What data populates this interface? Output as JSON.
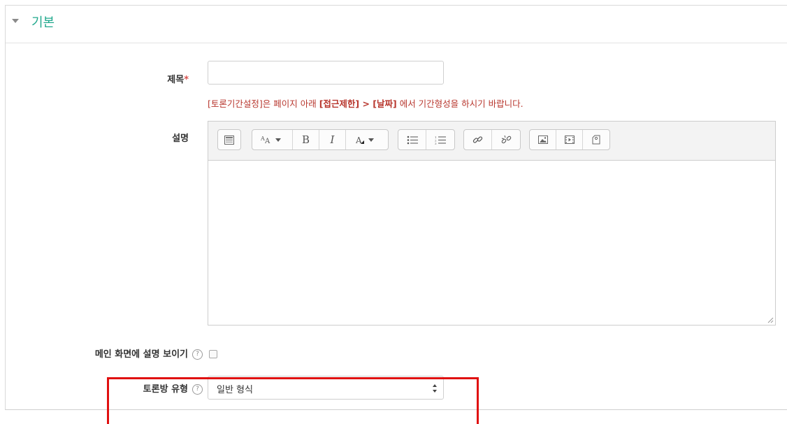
{
  "section": {
    "title": "기본"
  },
  "form": {
    "title_label": "제목",
    "required_mark": "*",
    "title_value": "",
    "notice_prefix": "[토론기간설정]은 페이지 아래 ",
    "notice_bold1": "[접근제한] > [날짜]",
    "notice_suffix": " 에서 기간형성을 하시기 바랍니다.",
    "description_label": "설명",
    "show_description_label": "메인 화면에 설명 보이기",
    "show_description_checked": false,
    "forum_type_label": "토론방 유형",
    "forum_type_value": "일반 형식",
    "help_glyph": "?"
  },
  "editor_toolbar": {
    "groups": [
      [
        "toolbar-toggle-icon"
      ],
      [
        "font-size-icon",
        "bold-icon",
        "italic-icon",
        "font-color-icon"
      ],
      [
        "bullet-list-icon",
        "numbered-list-icon"
      ],
      [
        "link-icon",
        "unlink-icon"
      ],
      [
        "image-icon",
        "media-icon",
        "manage-files-icon"
      ]
    ],
    "bold_glyph": "B",
    "italic_glyph": "I"
  },
  "colors": {
    "accent": "#22a98d",
    "notice": "#b8372e",
    "highlight": "#e01010"
  }
}
